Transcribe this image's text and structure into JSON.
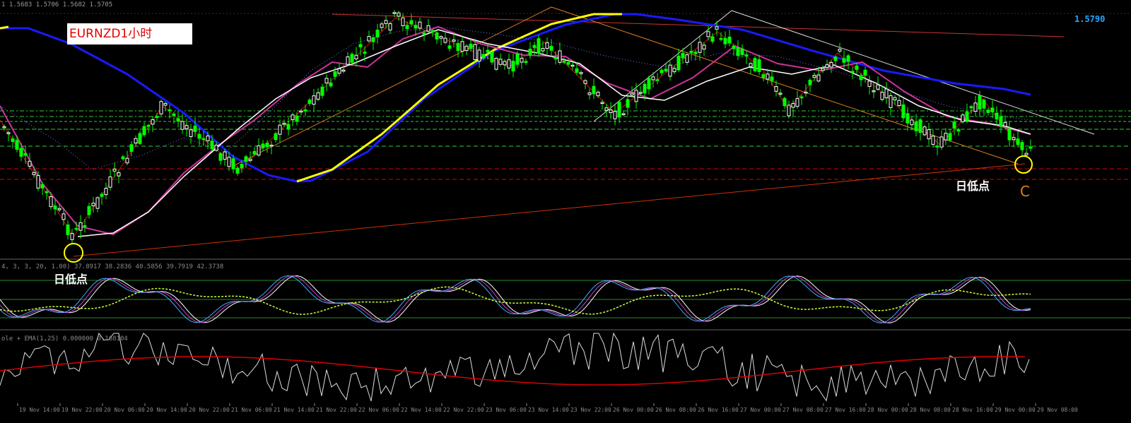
{
  "header": {
    "ohlc_readout": "1 1.5683 1.5706 1.5682 1.5705",
    "symbol_label": "EURNZD1小时"
  },
  "price_scale": {
    "current_price": "1.5790"
  },
  "annotations": {
    "left_low_label": "日低点",
    "right_low_label": "日低点",
    "point_label": "C"
  },
  "indicators": {
    "stoch_header": "4, 3, 3, 20, 1.00) 37.8917 38.2836 40.5856 39.7919 42.3738",
    "lower_header": "ole + EMA(1,25) 0.000000 0.168104"
  },
  "colors": {
    "background": "#000000",
    "bull_candle": "#00ff00",
    "bear_candle": "#ffffff",
    "ma_blue": "#1a1aff",
    "ma_yellow": "#ffff00",
    "ma_magenta": "#cc3399",
    "trend_orange": "#e08020",
    "trend_red": "#cc1111",
    "price_text": "#2aa7ff",
    "level_green": "#33cc33",
    "level_red": "#dd0000"
  },
  "chart_data": {
    "type": "line",
    "title": "EURNZD1小时",
    "x_tick_labels": [
      "19 Nov 14:00",
      "19 Nov 22:00",
      "20 Nov 06:00",
      "20 Nov 14:00",
      "20 Nov 22:00",
      "21 Nov 06:00",
      "21 Nov 14:00",
      "21 Nov 22:00",
      "22 Nov 06:00",
      "22 Nov 14:00",
      "22 Nov 22:00",
      "23 Nov 06:00",
      "23 Nov 14:00",
      "23 Nov 22:00",
      "26 Nov 00:00",
      "26 Nov 08:00",
      "26 Nov 16:00",
      "27 Nov 00:00",
      "27 Nov 08:00",
      "27 Nov 16:00",
      "28 Nov 00:00",
      "28 Nov 08:00",
      "28 Nov 16:00",
      "29 Nov 00:00",
      "29 Nov 08:00"
    ],
    "price_readout": 1.579,
    "panels": [
      "price",
      "stochastic",
      "oscillator+EMA"
    ]
  }
}
